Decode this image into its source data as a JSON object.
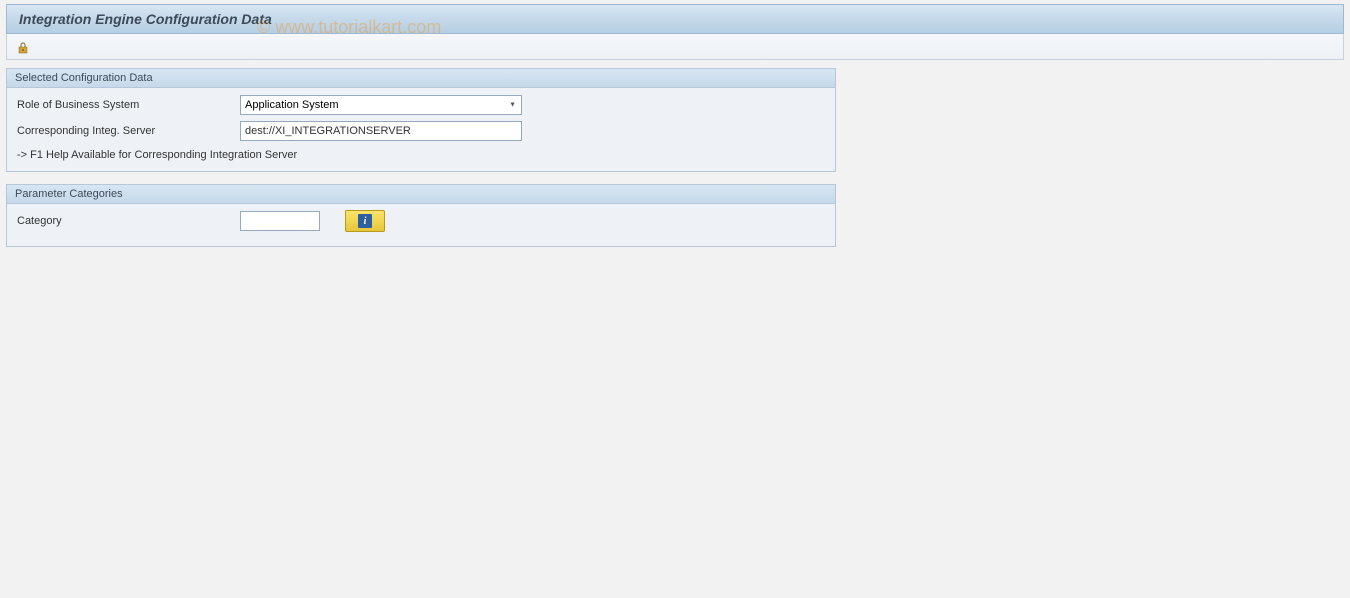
{
  "title": "Integration Engine Configuration Data",
  "watermark": "© www.tutorialkart.com",
  "panels": {
    "config": {
      "header": "Selected Configuration Data",
      "role_label": "Role of Business System",
      "role_value": "Application System",
      "server_label": "Corresponding Integ. Server",
      "server_value": "dest://XI_INTEGRATIONSERVER",
      "help_text": "-> F1 Help Available for Corresponding Integration Server"
    },
    "params": {
      "header": "Parameter Categories",
      "category_label": "Category",
      "category_value": ""
    }
  },
  "icons": {
    "toggle": "toggle-display-change",
    "info": "i"
  }
}
